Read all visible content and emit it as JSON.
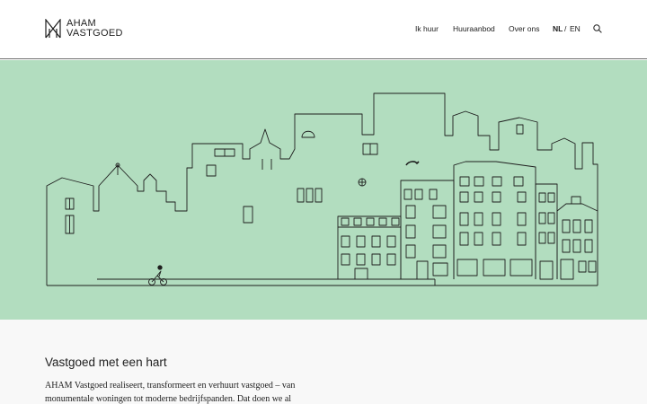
{
  "brand": {
    "line1": "AHAM",
    "line2": "VASTGOED",
    "logo_icon": "aham-monogram-icon"
  },
  "nav": {
    "items": [
      {
        "label": "Ik huur"
      },
      {
        "label": "Huuraanbod"
      },
      {
        "label": "Over ons"
      }
    ],
    "lang_nl": "NL",
    "lang_sep": "/",
    "lang_en": "EN",
    "search_icon": "search-icon"
  },
  "colors": {
    "hero_bg": "#b2ddbf",
    "line": "#1e1e1e",
    "content_bg": "#f8f8f8"
  },
  "hero": {
    "illustration": "canal-houses-line-illustration"
  },
  "intro": {
    "title": "Vastgoed met een hart",
    "body": "AHAM Vastgoed realiseert, transformeert en verhuurt vastgoed – van monumentale woningen tot moderne bedrijfspanden. Dat doen we al"
  }
}
